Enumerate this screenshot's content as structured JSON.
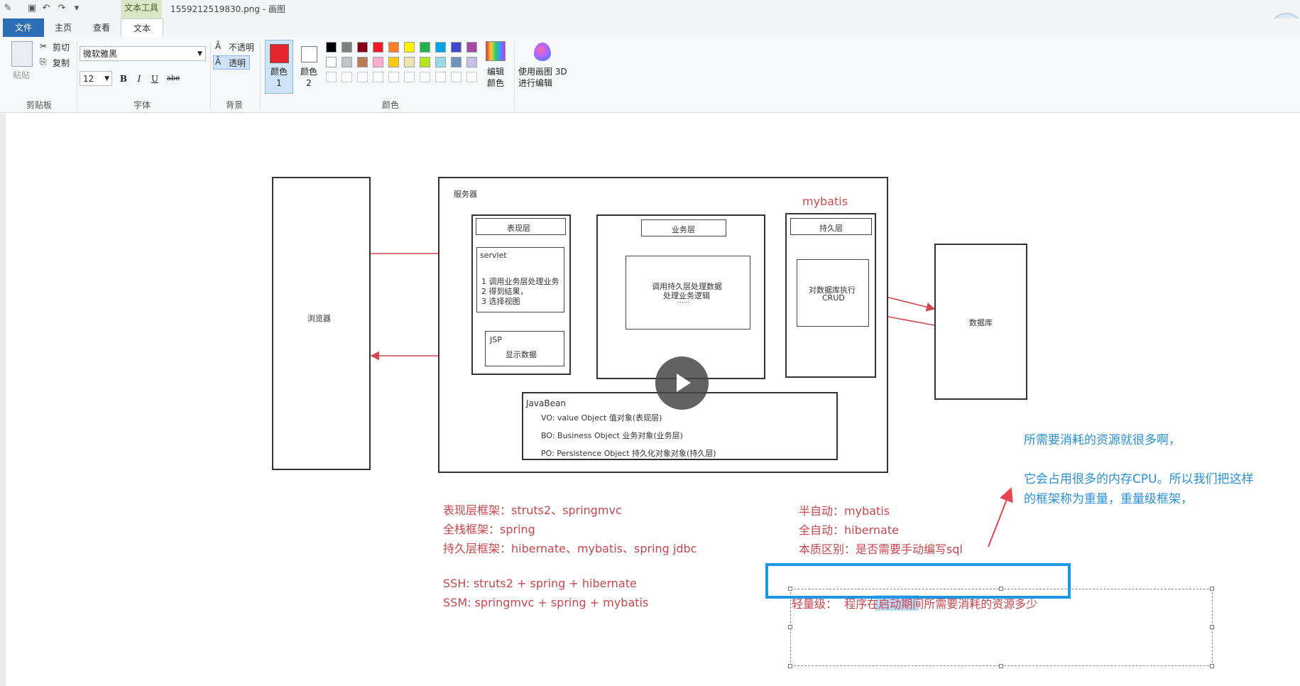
{
  "window": {
    "title": "1559212519830.png - 画图",
    "contextual_tab": "文本工具"
  },
  "tabs": [
    "文件",
    "主页",
    "查看",
    "文本"
  ],
  "clipboard": {
    "paste": "粘贴",
    "cut": "剪切",
    "copy": "复制",
    "group_label": "剪贴板"
  },
  "font": {
    "family": "微软雅黑",
    "size": "12",
    "bold": "B",
    "italic": "I",
    "underline": "U",
    "strike": "abe",
    "group_label": "字体"
  },
  "background": {
    "opaque": "不透明",
    "transparent": "透明",
    "group_label": "背景"
  },
  "colors": {
    "color1_label": "颜色 1",
    "color2_label": "颜色 2",
    "edit_colors": "编辑颜色",
    "paint3d": "使用画图 3D 进行编辑",
    "group_label": "颜色",
    "color1": "#e3262c",
    "color2": "#ffffff",
    "palette_row1": [
      "#000000",
      "#7f7f7f",
      "#880015",
      "#ed1c24",
      "#ff7f27",
      "#fff200",
      "#22b14c",
      "#00a2e8",
      "#3f48cc",
      "#a349a4"
    ],
    "palette_row2": [
      "#ffffff",
      "#c3c3c3",
      "#b97a57",
      "#ffaec9",
      "#ffc90e",
      "#efe4b0",
      "#b5e61d",
      "#99d9ea",
      "#7092be",
      "#c8bfe7"
    ]
  },
  "diagram": {
    "browser": "浏览器",
    "server": "服务器",
    "mybatis_label": "mybatis",
    "presentation_layer": "表现层",
    "servlet_title": "servlet",
    "servlet_steps": [
      "1 调用业务层处理业务",
      "2 得到结果，",
      "3 选择视图"
    ],
    "jsp_title": "JSP",
    "jsp_desc": "显示数据",
    "business_layer": "业务层",
    "business_desc_1": "调用持久层处理数据",
    "business_desc_2": "处理业务逻辑",
    "business_desc_3": "......",
    "persistence_layer": "持久层",
    "persistence_desc_1": "对数据库执行",
    "persistence_desc_2": "CRUD",
    "database": "数据库",
    "javabean_title": "JavaBean",
    "javabean_items": [
      "VO: value Object  值对象(表现层)",
      "BO: Business Object  业务对象(业务层)",
      "PO: Persistence Object  持久化对象对象(持久层)"
    ]
  },
  "notes_left": [
    "表现层框架：struts2、springmvc",
    "全栈框架：spring",
    "持久层框架：hibernate、mybatis、spring jdbc",
    "SSH:   struts2 + spring + hibernate",
    "SSM: springmvc + spring + mybatis"
  ],
  "notes_right": [
    "半自动：mybatis",
    "全自动：hibernate",
    "本质区别：是否需要手动编写sql"
  ],
  "editing_text": {
    "label": "轻量级：",
    "before": "程序在",
    "selected": "启动期间",
    "after": "所需要消耗的资源多少"
  },
  "annotation": [
    "所需要消耗的资源就很多啊，",
    "它会占用很多的内存CPU。所以我们把这样",
    "的框架称为重量，重量级框架，"
  ]
}
